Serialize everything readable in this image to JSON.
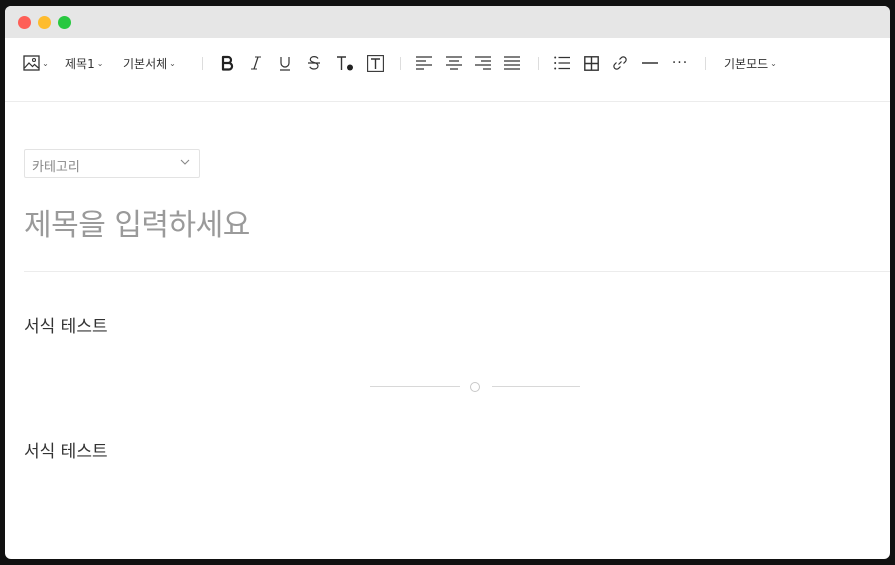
{
  "toolbar": {
    "heading_select": "제목1",
    "font_select": "기본서체",
    "mode_select": "기본모드",
    "more_label": "···"
  },
  "editor": {
    "category_placeholder": "카테고리",
    "title_placeholder": "제목을 입력하세요",
    "paragraphs": [
      "서식 테스트",
      "서식 테스트"
    ]
  },
  "colors": {
    "close": "#fe5f57",
    "minimize": "#febc2e",
    "maximize": "#28c840",
    "titlebar": "#e6e6e6"
  }
}
